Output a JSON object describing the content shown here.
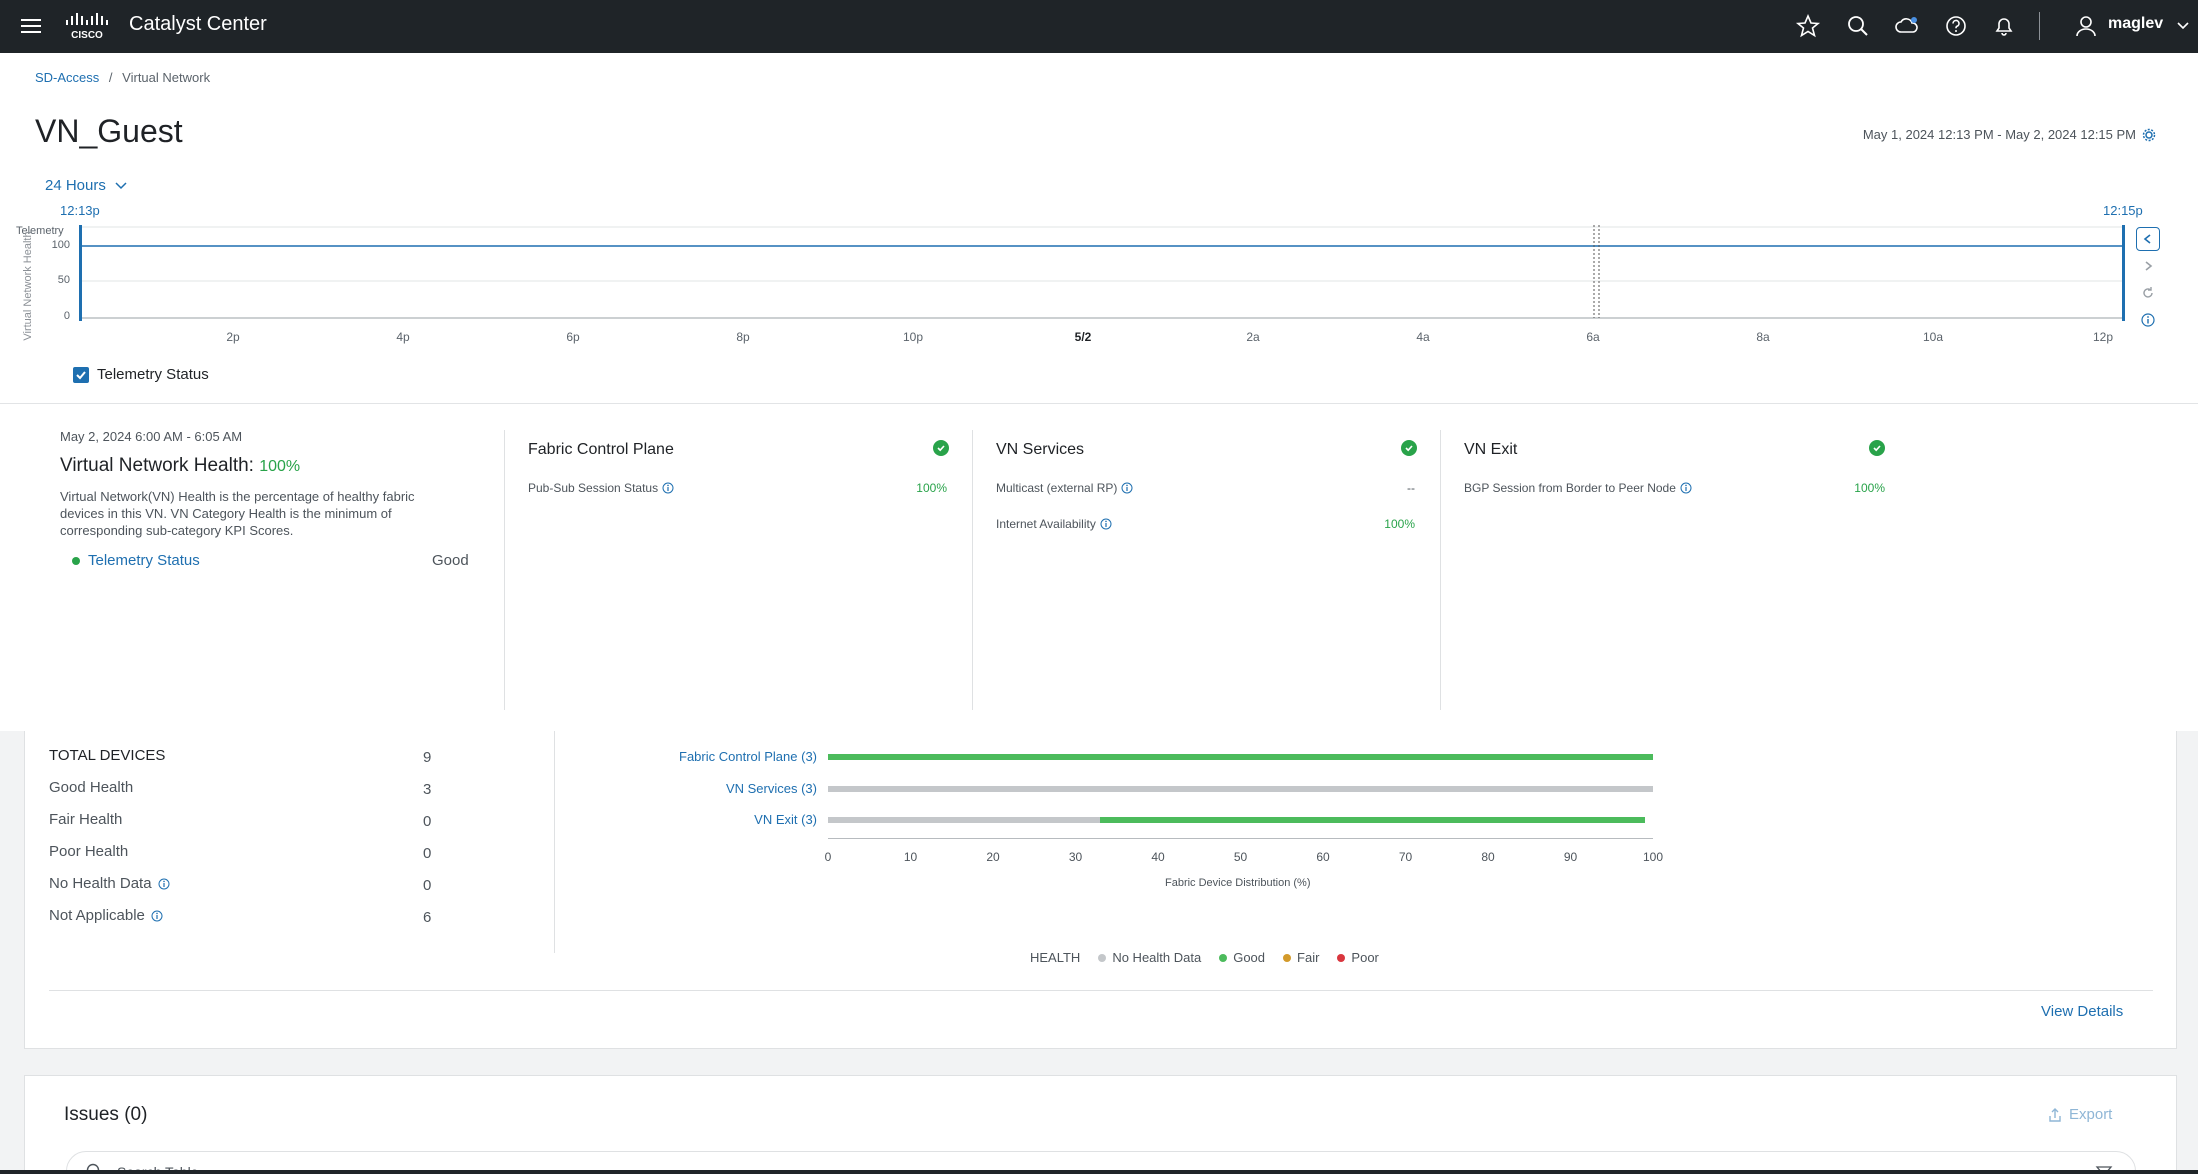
{
  "topbar": {
    "app_name": "Catalyst Center",
    "user": "maglev",
    "icons": [
      "menu-icon",
      "cisco-logo",
      "star-icon",
      "search-icon",
      "cloud-icon",
      "help-icon",
      "bell-icon",
      "user-icon",
      "chevron-down-icon"
    ]
  },
  "breadcrumb": {
    "parent": "SD-Access",
    "separator": "/",
    "current": "Virtual Network"
  },
  "page": {
    "title": "VN_Guest",
    "date_range": "May 1, 2024 12:13 PM - May 2, 2024 12:15 PM",
    "period": "24 Hours"
  },
  "timeline": {
    "start_label": "12:13p",
    "end_label": "12:15p",
    "y_label_top": "Telemetry",
    "y_axis_title": "Virtual Network Health",
    "y_ticks": [
      "100",
      "50",
      "0"
    ],
    "x_ticks": [
      "2p",
      "4p",
      "6p",
      "8p",
      "10p",
      "5/2",
      "2a",
      "4a",
      "6a",
      "8a",
      "10a",
      "12p"
    ],
    "health_value": 100,
    "checkbox_label": "Telemetry Status",
    "checkbox_checked": true
  },
  "health": {
    "window": "May 2, 2024 6:00 AM - 6:05 AM",
    "title": "Virtual Network Health:",
    "value": "100%",
    "description": "Virtual Network(VN) Health is the percentage of healthy fabric devices in this VN. VN Category Health is the minimum of corresponding sub-category KPI Scores.",
    "telemetry_label": "Telemetry Status",
    "telemetry_value": "Good",
    "categories": [
      {
        "title": "Fabric Control Plane",
        "kpis": [
          {
            "label": "Pub-Sub Session Status",
            "value": "100%"
          }
        ]
      },
      {
        "title": "VN Services",
        "kpis": [
          {
            "label": "Multicast (external RP)",
            "value": "--"
          },
          {
            "label": "Internet Availability",
            "value": "100%"
          }
        ]
      },
      {
        "title": "VN Exit",
        "kpis": [
          {
            "label": "BGP Session from Border to Peer Node",
            "value": "100%"
          }
        ]
      }
    ]
  },
  "devices": {
    "stats": [
      {
        "label": "TOTAL DEVICES",
        "value": "9"
      },
      {
        "label": "Good Health",
        "value": "3"
      },
      {
        "label": "Fair Health",
        "value": "0"
      },
      {
        "label": "Poor Health",
        "value": "0"
      },
      {
        "label": "No Health Data",
        "value": "0"
      },
      {
        "label": "Not Applicable",
        "value": "6"
      }
    ],
    "view_details": "View Details"
  },
  "chart_data": {
    "type": "bar",
    "orientation": "horizontal",
    "stacked": true,
    "categories": [
      "Fabric Control Plane (3)",
      "VN Services (3)",
      "VN Exit (3)"
    ],
    "series": [
      {
        "name": "No Health Data",
        "values": [
          0,
          100,
          33
        ]
      },
      {
        "name": "Good",
        "values": [
          100,
          0,
          66
        ]
      },
      {
        "name": "Fair",
        "values": [
          0,
          0,
          0
        ]
      },
      {
        "name": "Poor",
        "values": [
          0,
          0,
          0
        ]
      }
    ],
    "xlabel": "Fabric Device Distribution (%)",
    "xlim": [
      0,
      100
    ],
    "x_ticks": [
      "0",
      "10",
      "20",
      "30",
      "40",
      "50",
      "60",
      "70",
      "80",
      "90",
      "100"
    ],
    "legend_title": "HEALTH",
    "legend_placement": "bottom",
    "colors": {
      "No Health Data": "#c4c7ca",
      "Good": "#4cbb5c",
      "Fair": "#d39a2b",
      "Poor": "#d9363e"
    }
  },
  "issues": {
    "title": "Issues (0)",
    "export_label": "Export",
    "search_placeholder": "Search Table"
  },
  "colors": {
    "accent": "#1e6fb0",
    "good": "#29a34a",
    "topbar": "#1f2428"
  }
}
